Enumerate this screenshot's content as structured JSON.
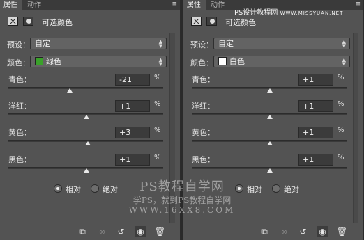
{
  "watermark": {
    "top": "PS设计教程网",
    "top_site": "WWW.MISSYUAN.NET",
    "line1": "PS教程自学网",
    "line2": "学PS，就到PS教程自学网",
    "line3": "WWW.16XX8.COM"
  },
  "left": {
    "tabs": {
      "active": "属性",
      "inactive": "动作",
      "menu": "≡"
    },
    "title": "可选颜色",
    "preset": {
      "label": "预设：",
      "value": "自定"
    },
    "color": {
      "label": "颜色：",
      "value": "绿色",
      "swatch": "#3aa12a"
    },
    "sliders": [
      {
        "label": "青色：",
        "value": "-21",
        "unit": "%",
        "level": 0.395
      },
      {
        "label": "洋红：",
        "value": "+1",
        "unit": "%",
        "level": 0.505
      },
      {
        "label": "黄色：",
        "value": "+3",
        "unit": "%",
        "level": 0.515
      },
      {
        "label": "黑色：",
        "value": "+1",
        "unit": "%",
        "level": 0.505
      }
    ],
    "method": {
      "relative": "相对",
      "absolute": "绝对",
      "selected": "relative"
    }
  },
  "right": {
    "tabs": {
      "active": "属性",
      "inactive": "动作",
      "menu": "≡"
    },
    "title": "可选颜色",
    "preset": {
      "label": "预设：",
      "value": "自定"
    },
    "color": {
      "label": "颜色：",
      "value": "白色",
      "swatch": "#ffffff"
    },
    "sliders": [
      {
        "label": "青色：",
        "value": "+1",
        "unit": "%",
        "level": 0.505
      },
      {
        "label": "洋红：",
        "value": "+1",
        "unit": "%",
        "level": 0.505
      },
      {
        "label": "黄色：",
        "value": "+1",
        "unit": "%",
        "level": 0.505
      },
      {
        "label": "黑色：",
        "value": "+1",
        "unit": "%",
        "level": 0.505
      }
    ],
    "method": {
      "relative": "相对",
      "absolute": "绝对",
      "selected": "relative"
    }
  },
  "icons": [
    "clip-to-layer-icon",
    "view-previous-icon",
    "reset-icon",
    "visibility-icon",
    "delete-icon"
  ]
}
